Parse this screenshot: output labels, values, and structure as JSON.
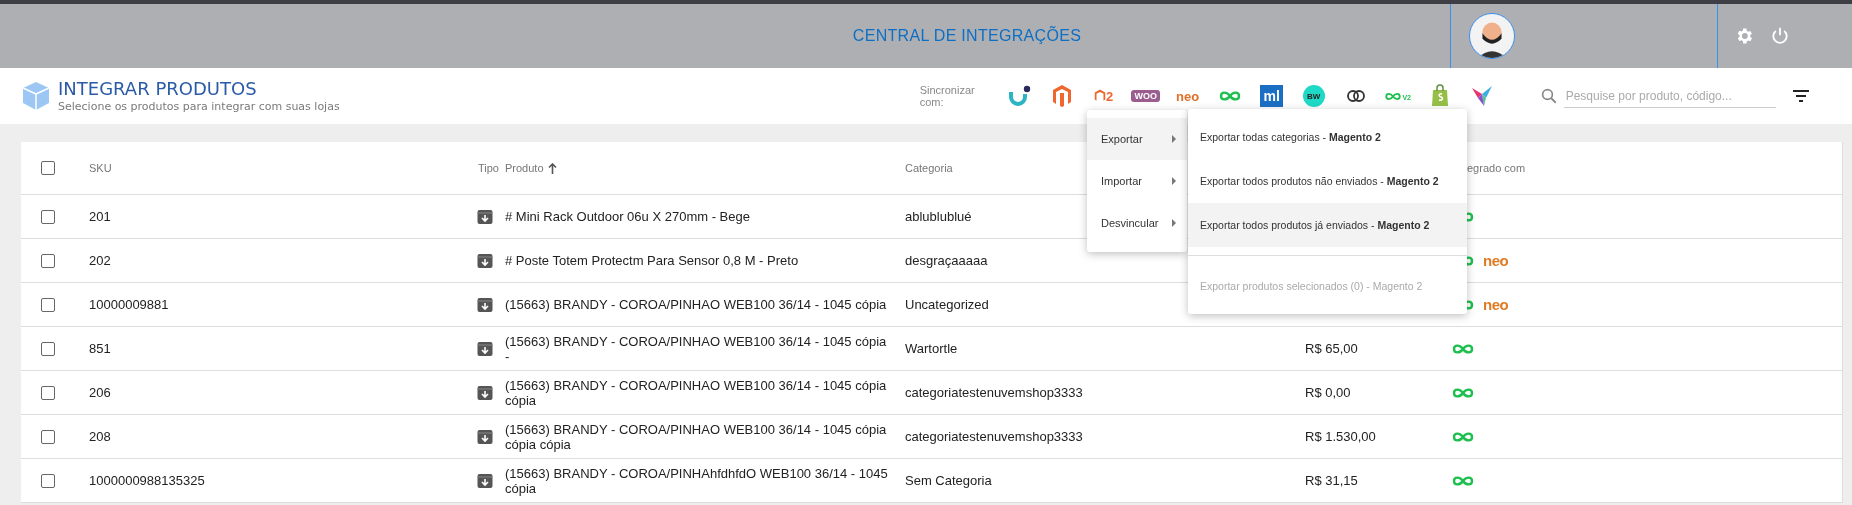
{
  "header": {
    "title": "CENTRAL DE INTEGRAÇÕES"
  },
  "page": {
    "title": "INTEGRAR PRODUTOS",
    "subtitle": "Selecione os produtos para integrar com suas lojas"
  },
  "sync": {
    "label": "Sincronizar com:",
    "stores": [
      {
        "kind": "u-logo"
      },
      {
        "kind": "magento"
      },
      {
        "kind": "magento2",
        "label": "2"
      },
      {
        "kind": "woo",
        "label": "WOO"
      },
      {
        "kind": "neo",
        "label": "neo"
      },
      {
        "kind": "infinity"
      },
      {
        "kind": "ml",
        "label": "ml"
      },
      {
        "kind": "bw",
        "label": "BW"
      },
      {
        "kind": "rings"
      },
      {
        "kind": "infinity-v2",
        "label": "V2"
      },
      {
        "kind": "shopify"
      },
      {
        "kind": "star"
      }
    ]
  },
  "search": {
    "placeholder": "Pesquise por produto, código..."
  },
  "table": {
    "select_all": {
      "checked": false
    },
    "columns": [
      {
        "kind": "sku",
        "label": "SKU"
      },
      {
        "kind": "tipo",
        "label": "Tipo"
      },
      {
        "kind": "produto",
        "label": "Produto",
        "sorted": true
      },
      {
        "kind": "categoria",
        "label": "Categoria"
      },
      {
        "kind": "integrado",
        "label": "egrado com"
      }
    ],
    "rows": [
      {
        "checked": false,
        "sku": "201",
        "product": "# Mini Rack Outdoor 06u X 270mm - Bege",
        "category": "ablublublué",
        "integrations": [
          {
            "kind": "infinity"
          }
        ]
      },
      {
        "checked": false,
        "sku": "202",
        "product": "# Poste Totem Protectm Para Sensor 0,8 M - Preto",
        "category": "desgraçaaaaa",
        "integrations": [
          {
            "kind": "infinity"
          },
          {
            "kind": "neo",
            "label": "neo"
          }
        ]
      },
      {
        "checked": false,
        "sku": "10000009881",
        "product": "(15663) BRANDY - COROA/PINHAO WEB100 36/14 - 1045 cópia",
        "category": "Uncategorized",
        "integrations": [
          {
            "kind": "infinity"
          },
          {
            "kind": "neo",
            "label": "neo"
          }
        ]
      },
      {
        "checked": false,
        "sku": "851",
        "product": "(15663) BRANDY - COROA/PINHAO WEB100 36/14 - 1045 cópia -",
        "category": "Wartortle",
        "price": "R$ 65,00",
        "integrations": [
          {
            "kind": "infinity"
          }
        ]
      },
      {
        "checked": false,
        "sku": "206",
        "product": "(15663) BRANDY - COROA/PINHAO WEB100 36/14 - 1045 cópia cópia",
        "category": "categoriatestenuvemshop3333",
        "price": "R$ 0,00",
        "integrations": [
          {
            "kind": "infinity"
          }
        ]
      },
      {
        "checked": false,
        "sku": "208",
        "product": "(15663) BRANDY - COROA/PINHAO WEB100 36/14 - 1045 cópia cópia cópia",
        "category": "categoriatestenuvemshop3333",
        "price": "R$ 1.530,00",
        "integrations": [
          {
            "kind": "infinity"
          }
        ]
      },
      {
        "checked": false,
        "sku": "1000000988135325",
        "product": "(15663) BRANDY - COROA/PINHAhfdhfdO WEB100 36/14 - 1045 cópia",
        "category": "Sem Categoria",
        "price": "R$ 31,15",
        "integrations": [
          {
            "kind": "infinity"
          }
        ]
      }
    ]
  },
  "menu": {
    "items": [
      {
        "label": "Exportar",
        "selected": true
      },
      {
        "label": "Importar",
        "selected": false
      },
      {
        "label": "Desvincular",
        "selected": false
      }
    ],
    "submenu": [
      {
        "label": "Exportar todas categorias - **Magento 2**",
        "selected": false,
        "disabled": false
      },
      {
        "label": "Exportar todos produtos não enviados - **Magento 2**",
        "selected": false,
        "disabled": false
      },
      {
        "label": "Exportar todos produtos já enviados - **Magento 2**",
        "selected": true,
        "disabled": false
      },
      {
        "label": "Exportar produtos selecionados (0) - Magento 2",
        "selected": false,
        "disabled": true
      }
    ]
  }
}
